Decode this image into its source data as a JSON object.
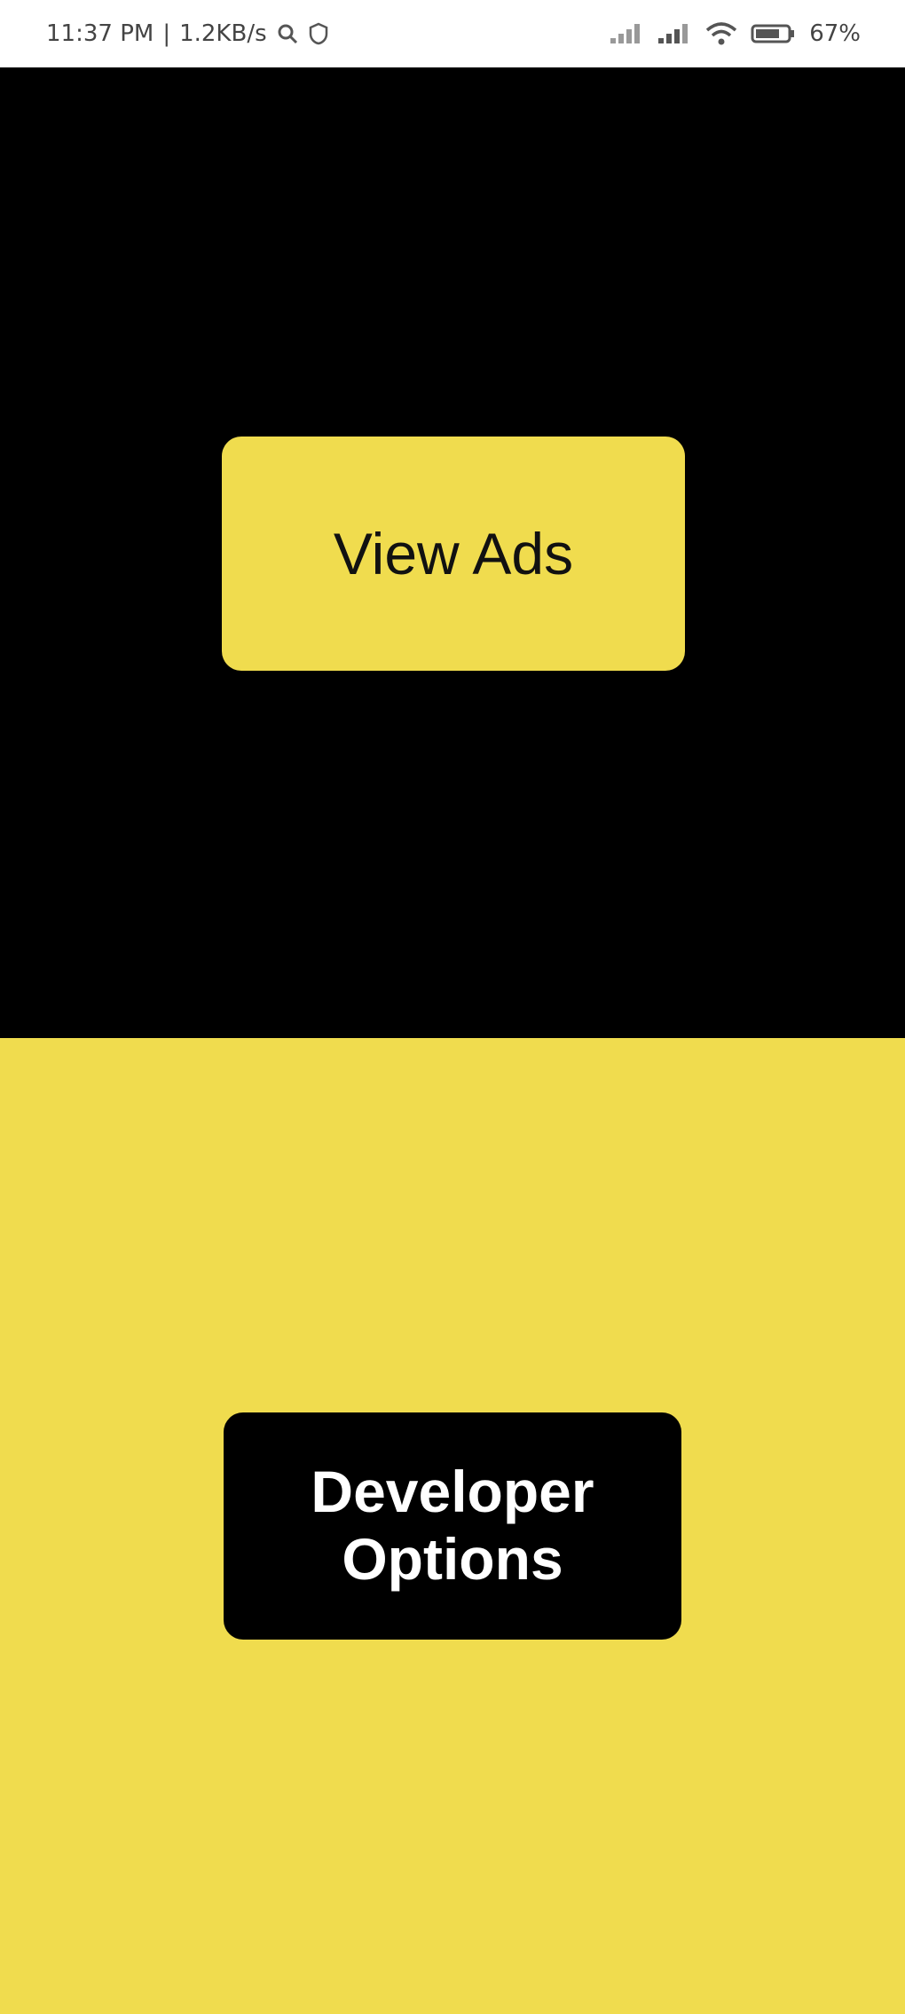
{
  "status_bar": {
    "time": "11:37 PM",
    "separator": "|",
    "network_speed": "1.2KB/s",
    "battery": "67%",
    "icons": [
      "signal-icon",
      "signal-icon",
      "wifi-icon",
      "battery-icon"
    ]
  },
  "top_panel": {
    "view_ads_label": "View Ads"
  },
  "bottom_panel": {
    "developer_options_label": "Developer Options"
  },
  "colors": {
    "accent_yellow": "#f0dc4e",
    "dark": "#000000",
    "light_text": "#ffffff"
  }
}
